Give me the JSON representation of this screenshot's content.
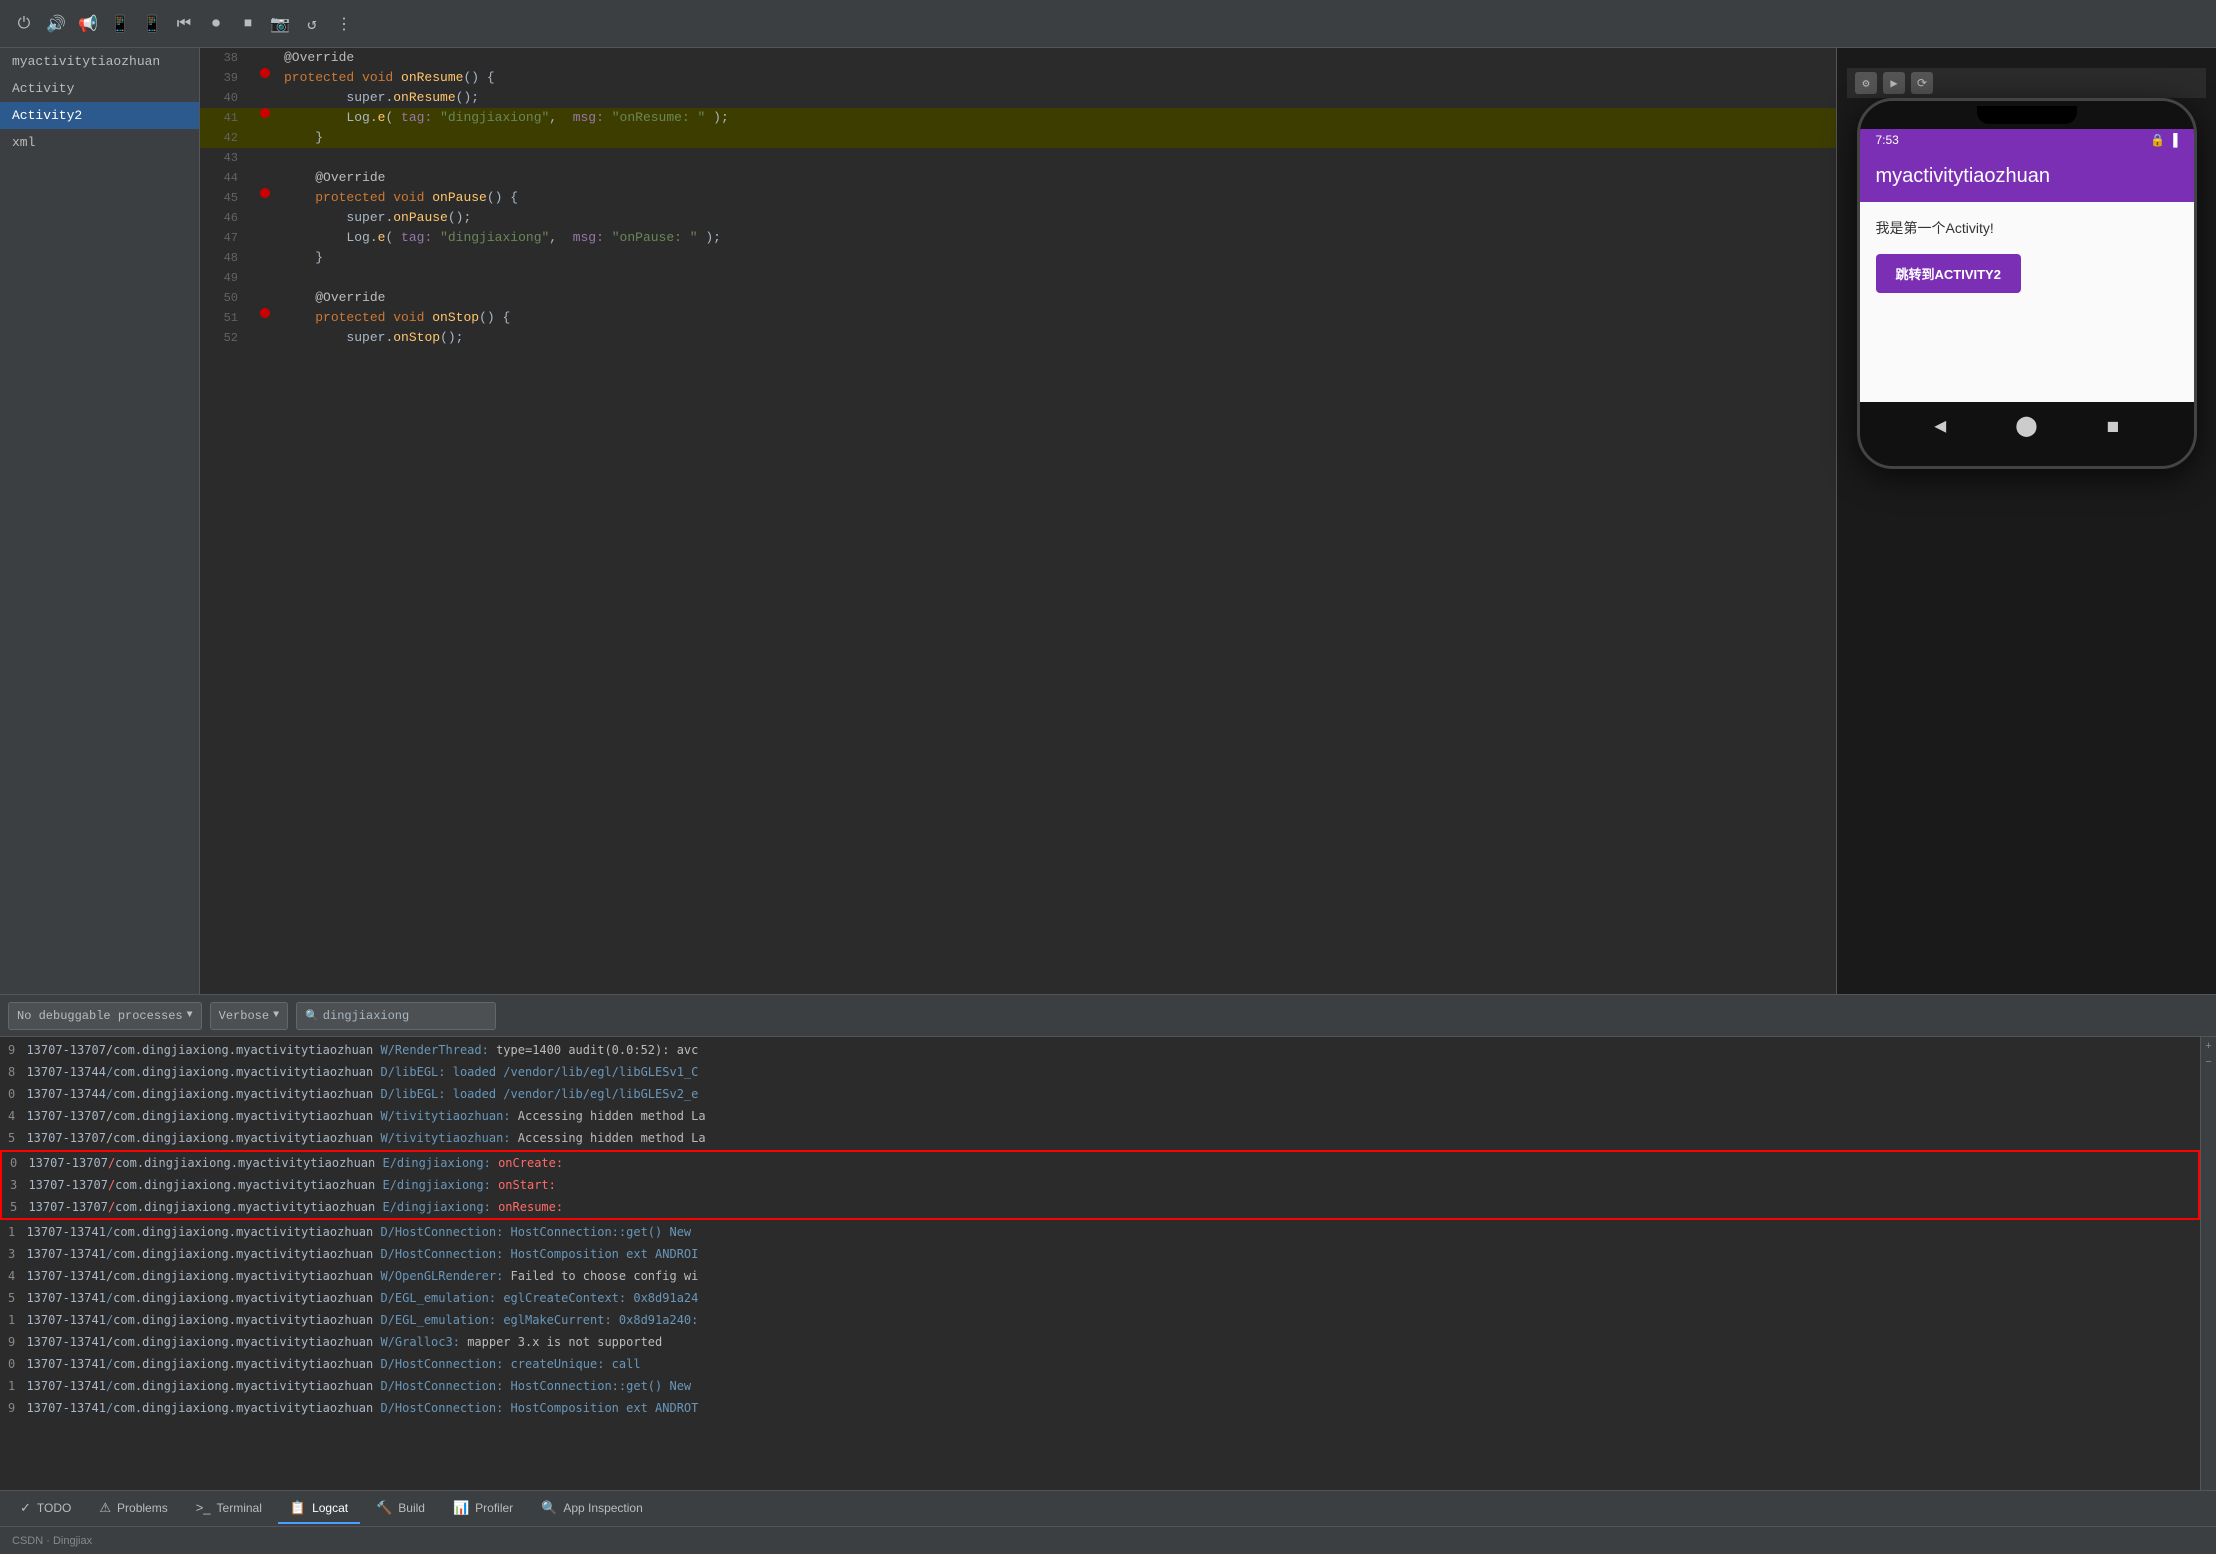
{
  "toolbar": {
    "icons": [
      "⏻",
      "🔊",
      "📢",
      "📱",
      "📱",
      "⏮",
      "⏺",
      "⏹",
      "📷",
      "↺",
      "⋮"
    ]
  },
  "sidebar": {
    "items": [
      {
        "label": "myactivitytiaozhuan",
        "selected": false
      },
      {
        "label": "Activity",
        "selected": false
      },
      {
        "label": "Activity2",
        "selected": true
      },
      {
        "label": "xml",
        "selected": false
      }
    ]
  },
  "editor": {
    "lines": [
      {
        "num": "38",
        "content": "@Override",
        "type": "annotation",
        "breakpoint": false,
        "highlighted": false
      },
      {
        "num": "39",
        "content": "    protected void onResume() {",
        "type": "code",
        "breakpoint": true,
        "highlighted": false
      },
      {
        "num": "40",
        "content": "        super.onResume();",
        "type": "code",
        "breakpoint": false,
        "highlighted": false
      },
      {
        "num": "41",
        "content": "        Log.e( tag: \"dingjiaxiong\",  msg: \"onResume: \" );",
        "type": "code",
        "breakpoint": true,
        "highlighted": true
      },
      {
        "num": "42",
        "content": "    }",
        "type": "code",
        "breakpoint": false,
        "highlighted": true
      },
      {
        "num": "43",
        "content": "",
        "type": "code",
        "breakpoint": false,
        "highlighted": false
      },
      {
        "num": "44",
        "content": "    @Override",
        "type": "annotation",
        "breakpoint": false,
        "highlighted": false
      },
      {
        "num": "45",
        "content": "    protected void onPause() {",
        "type": "code",
        "breakpoint": true,
        "highlighted": false
      },
      {
        "num": "46",
        "content": "        super.onPause();",
        "type": "code",
        "breakpoint": false,
        "highlighted": false
      },
      {
        "num": "47",
        "content": "        Log.e( tag: \"dingjiaxiong\",  msg: \"onPause: \" );",
        "type": "code",
        "breakpoint": false,
        "highlighted": false
      },
      {
        "num": "48",
        "content": "    }",
        "type": "code",
        "breakpoint": false,
        "highlighted": false
      },
      {
        "num": "49",
        "content": "",
        "type": "code",
        "breakpoint": false,
        "highlighted": false
      },
      {
        "num": "50",
        "content": "    @Override",
        "type": "annotation",
        "breakpoint": false,
        "highlighted": false
      },
      {
        "num": "51",
        "content": "    protected void onStop() {",
        "type": "code",
        "breakpoint": true,
        "highlighted": false
      },
      {
        "num": "52",
        "content": "        super.onStop();",
        "type": "code",
        "breakpoint": false,
        "highlighted": false
      }
    ]
  },
  "phone": {
    "time": "7:53",
    "app_title": "myactivitytiaozhuan",
    "content_text": "我是第一个Activity!",
    "button_label": "跳转到ACTIVITY2",
    "accent_color": "#7b2fb5"
  },
  "logcat": {
    "process_dropdown": "No debuggable processes",
    "level_dropdown": "Verbose",
    "search_placeholder": "dingjiaxiong",
    "lines": [
      {
        "num": "9",
        "pid": "13707-13707",
        "pkg": "com.dingjiaxiong.myactivitytiaozhuan",
        "level": "W",
        "tag": "RenderThread",
        "msg": "type=1400 audit(0.0:52): avc",
        "type": "warn"
      },
      {
        "num": "8",
        "pid": "13707-13744",
        "pkg": "com.dingjiaxiong.myactivitytiaozhuan",
        "level": "D",
        "tag": "libEGL",
        "msg": "loaded /vendor/lib/egl/libGLESv1_C",
        "type": "debug"
      },
      {
        "num": "0",
        "pid": "13707-13744",
        "pkg": "com.dingjiaxiong.myactivitytiaozhuan",
        "level": "D",
        "tag": "libEGL",
        "msg": "loaded /vendor/lib/egl/libGLESv2_e",
        "type": "debug"
      },
      {
        "num": "4",
        "pid": "13707-13707",
        "pkg": "com.dingjiaxiong.myactivitytiaozhuan",
        "level": "W",
        "tag": "tivitytiaozhuan",
        "msg": "Accessing hidden method La",
        "type": "warn"
      },
      {
        "num": "5",
        "pid": "13707-13707",
        "pkg": "com.dingjiaxiong.myactivitytiaozhuan",
        "level": "W",
        "tag": "tivitytiaozhuan",
        "msg": "Accessing hidden method La",
        "type": "warn"
      },
      {
        "num": "0",
        "pid": "13707-13707",
        "pkg": "com.dingjiaxiong.myactivitytiaozhuan",
        "level": "E",
        "tag": "dingjiaxiong",
        "msg": "onCreate:",
        "type": "error",
        "highlight": true
      },
      {
        "num": "3",
        "pid": "13707-13707",
        "pkg": "com.dingjiaxiong.myactivitytiaozhuan",
        "level": "E",
        "tag": "dingjiaxiong",
        "msg": "onStart:",
        "type": "error",
        "highlight": true
      },
      {
        "num": "5",
        "pid": "13707-13707",
        "pkg": "com.dingjiaxiong.myactivitytiaozhuan",
        "level": "E",
        "tag": "dingjiaxiong",
        "msg": "onResume:",
        "type": "error",
        "highlight": true
      },
      {
        "num": "1",
        "pid": "13707-13741",
        "pkg": "com.dingjiaxiong.myactivitytiaozhuan",
        "level": "D",
        "tag": "HostConnection",
        "msg": "HostConnection::get() New",
        "type": "debug"
      },
      {
        "num": "3",
        "pid": "13707-13741",
        "pkg": "com.dingjiaxiong.myactivitytiaozhuan",
        "level": "D",
        "tag": "HostConnection",
        "msg": "HostComposition ext ANDROI",
        "type": "debug"
      },
      {
        "num": "4",
        "pid": "13707-13741",
        "pkg": "com.dingjiaxiong.myactivitytiaozhuan",
        "level": "W",
        "tag": "OpenGLRenderer",
        "msg": "Failed to choose config wi",
        "type": "warn"
      },
      {
        "num": "5",
        "pid": "13707-13741",
        "pkg": "com.dingjiaxiong.myactivitytiaozhuan",
        "level": "D",
        "tag": "EGL_emulation",
        "msg": "eglCreateContext: 0x8d91a24",
        "type": "debug"
      },
      {
        "num": "1",
        "pid": "13707-13741",
        "pkg": "com.dingjiaxiong.myactivitytiaozhuan",
        "level": "D",
        "tag": "EGL_emulation",
        "msg": "eglMakeCurrent: 0x8d91a240:",
        "type": "debug"
      },
      {
        "num": "9",
        "pid": "13707-13741",
        "pkg": "com.dingjiaxiong.myactivitytiaozhuan",
        "level": "W",
        "tag": "Gralloc3",
        "msg": "mapper 3.x is not supported",
        "type": "warn"
      },
      {
        "num": "0",
        "pid": "13707-13741",
        "pkg": "com.dingjiaxiong.myactivitytiaozhuan",
        "level": "D",
        "tag": "HostConnection",
        "msg": "createUnique: call",
        "type": "debug"
      },
      {
        "num": "1",
        "pid": "13707-13741",
        "pkg": "com.dingjiaxiong.myactivitytiaozhuan",
        "level": "D",
        "tag": "HostConnection",
        "msg": "HostConnection::get() New",
        "type": "debug"
      },
      {
        "num": "9",
        "pid": "13707-13741",
        "pkg": "com.dingjiaxiong.myactivitytiaozhuan",
        "level": "D",
        "tag": "HostConnection",
        "msg": "HostComposition ext ANDROT",
        "type": "debug"
      }
    ]
  },
  "bottom_tabs": [
    {
      "label": "TODO",
      "icon": "✓",
      "active": false
    },
    {
      "label": "Problems",
      "icon": "⚠",
      "active": false
    },
    {
      "label": "Terminal",
      "icon": ">_",
      "active": false
    },
    {
      "label": "Logcat",
      "icon": "📋",
      "active": true
    },
    {
      "label": "Build",
      "icon": "🔨",
      "active": false
    },
    {
      "label": "Profiler",
      "icon": "📊",
      "active": false
    },
    {
      "label": "App Inspection",
      "icon": "🔍",
      "active": false
    }
  ],
  "status_bar": {
    "right_text": "CSDN · Dingjiax"
  }
}
